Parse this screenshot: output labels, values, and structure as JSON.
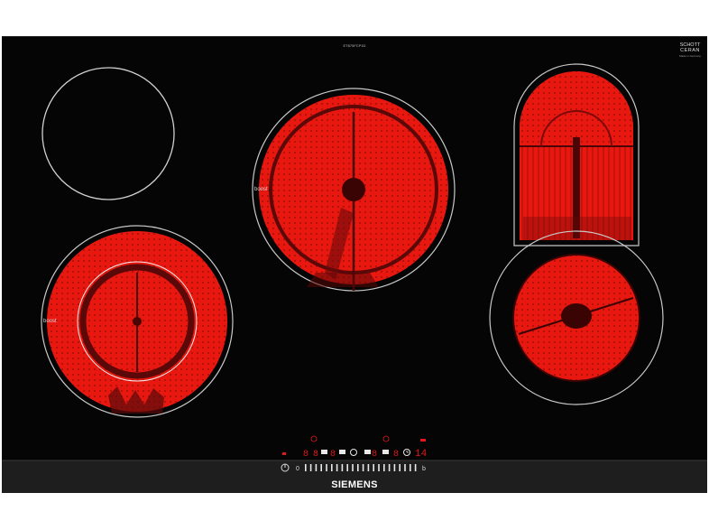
{
  "model_code": "ET875FCP1D",
  "glass_brand": {
    "line1": "SCHOTT",
    "line2": "CERAN"
  },
  "glass_sub": "Made in Germany",
  "boost_label_top": "boost",
  "boost_label_bottom": "boost",
  "brand": "SIEMENS",
  "controls": {
    "power_symbol": "⏻",
    "slider_start": "0",
    "slider_end": "b",
    "timer_value": "14",
    "zone_digits": [
      "8",
      "8",
      "8",
      "8",
      "8"
    ],
    "icons": [
      "power-icon",
      "clock-icon",
      "lock-icon",
      "childlock-icon",
      "warm-icon"
    ]
  },
  "colors": {
    "glass": "#050505",
    "heat": "#e81810",
    "heat_dark": "#6a0a0a",
    "ring": "#c8c8c8",
    "display": "#e01818",
    "strip": "#1e1e1e"
  },
  "zones": [
    {
      "id": "rear-left",
      "state": "off"
    },
    {
      "id": "front-left",
      "state": "on",
      "type": "dual-with-boost"
    },
    {
      "id": "center",
      "state": "on",
      "type": "dual-with-boost"
    },
    {
      "id": "rear-right",
      "state": "on",
      "type": "oval-roaster"
    },
    {
      "id": "front-right",
      "state": "on",
      "type": "single"
    }
  ]
}
